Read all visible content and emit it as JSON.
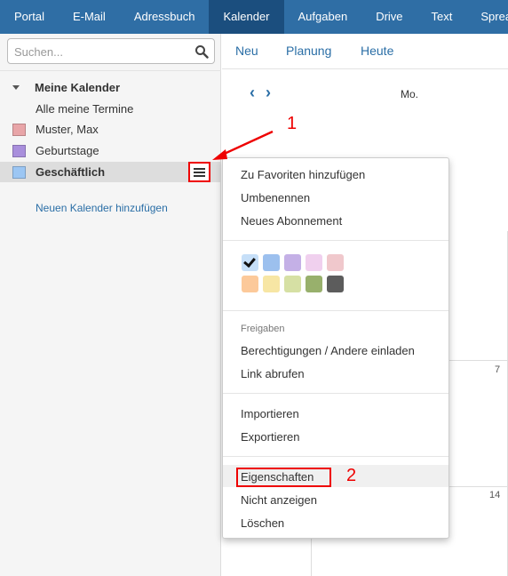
{
  "topnav": {
    "tabs": [
      "Portal",
      "E-Mail",
      "Adressbuch",
      "Kalender",
      "Aufgaben",
      "Drive",
      "Text",
      "Sprea"
    ],
    "active_index": 3
  },
  "sidebar": {
    "search_placeholder": "Suchen...",
    "folder_title": "Meine Kalender",
    "all_appointments": "Alle meine Termine",
    "calendars": [
      {
        "label": "Muster, Max",
        "color": "#e8a5a8"
      },
      {
        "label": "Geburtstage",
        "color": "#a98fdc"
      },
      {
        "label": "Geschäftlich",
        "color": "#9cc6f3",
        "selected": true
      }
    ],
    "add_calendar": "Neuen Kalender hinzufügen"
  },
  "toolbar": {
    "new_label": "Neu",
    "planning_label": "Planung",
    "today_label": "Heute"
  },
  "calendar": {
    "prev_icon": "chevron-left-icon",
    "next_icon": "chevron-right-icon",
    "day_header": "Mo.",
    "day_numbers": [
      "7",
      "14"
    ]
  },
  "context_menu": {
    "items_group1": [
      "Zu Favoriten hinzufügen",
      "Umbenennen",
      "Neues Abonnement"
    ],
    "colors_row1": [
      "#c6dff8",
      "#9cc0ee",
      "#c4b0e6",
      "#f0d0ee",
      "#f0c8cc"
    ],
    "colors_row2": [
      "#fcc99a",
      "#f7e6a4",
      "#d6e0a4",
      "#98b06c",
      "#5c5c5c"
    ],
    "selected_color_index": 0,
    "share_header": "Freigaben",
    "items_group3": [
      "Berechtigungen / Andere einladen",
      "Link abrufen"
    ],
    "items_group4": [
      "Importieren",
      "Exportieren"
    ],
    "items_group5": [
      "Eigenschaften",
      "Nicht anzeigen",
      "Löschen"
    ]
  },
  "annotations": {
    "label1": "1",
    "label2": "2",
    "color": "#ee0000"
  }
}
